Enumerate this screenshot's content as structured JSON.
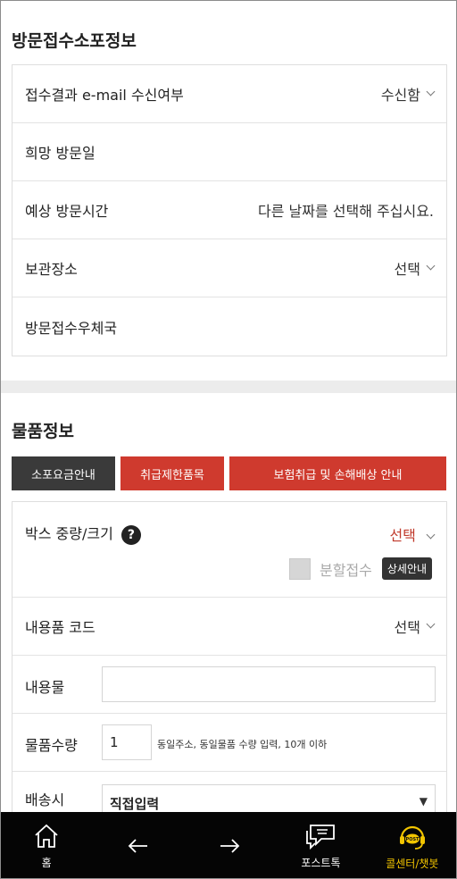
{
  "visit_info": {
    "title": "방문접수소포정보",
    "rows": [
      {
        "label": "접수결과 e-mail 수신여부",
        "value": "수신함"
      },
      {
        "label": "희망 방문일",
        "value": ""
      },
      {
        "label": "예상 방문시간",
        "value": "다른 날짜를 선택해 주십시요."
      },
      {
        "label": "보관장소",
        "value": "선택"
      },
      {
        "label": "방문접수우체국",
        "value": ""
      }
    ]
  },
  "item_info": {
    "title": "물품정보",
    "buttons": {
      "rates": "소포요금안내",
      "restricted": "취급제한품목",
      "insurance": "보험취급 및 손해배상 안내"
    },
    "box": {
      "label": "박스 중량/크기",
      "help": "?",
      "value": "선택",
      "split_label": "분할접수",
      "detail_button": "상세안내"
    },
    "content_code": {
      "label": "내용품 코드",
      "value": "선택"
    },
    "contents": {
      "label": "내용물",
      "value": ""
    },
    "quantity": {
      "label": "물품수량",
      "value": "1",
      "note": "동일주소, 동일물품 수량 입력, 10개 이하"
    },
    "delivery": {
      "label": "배송시",
      "selected": "직접입력"
    }
  },
  "bottom_nav": {
    "home": "홈",
    "post_talk": "포스트톡",
    "call_center": "콜센터/챗봇",
    "chat_badge": "POST"
  },
  "colors": {
    "accent_red": "#cf3a2e",
    "dark_button": "#3a3a3a",
    "active_nav": "#f2c500"
  }
}
